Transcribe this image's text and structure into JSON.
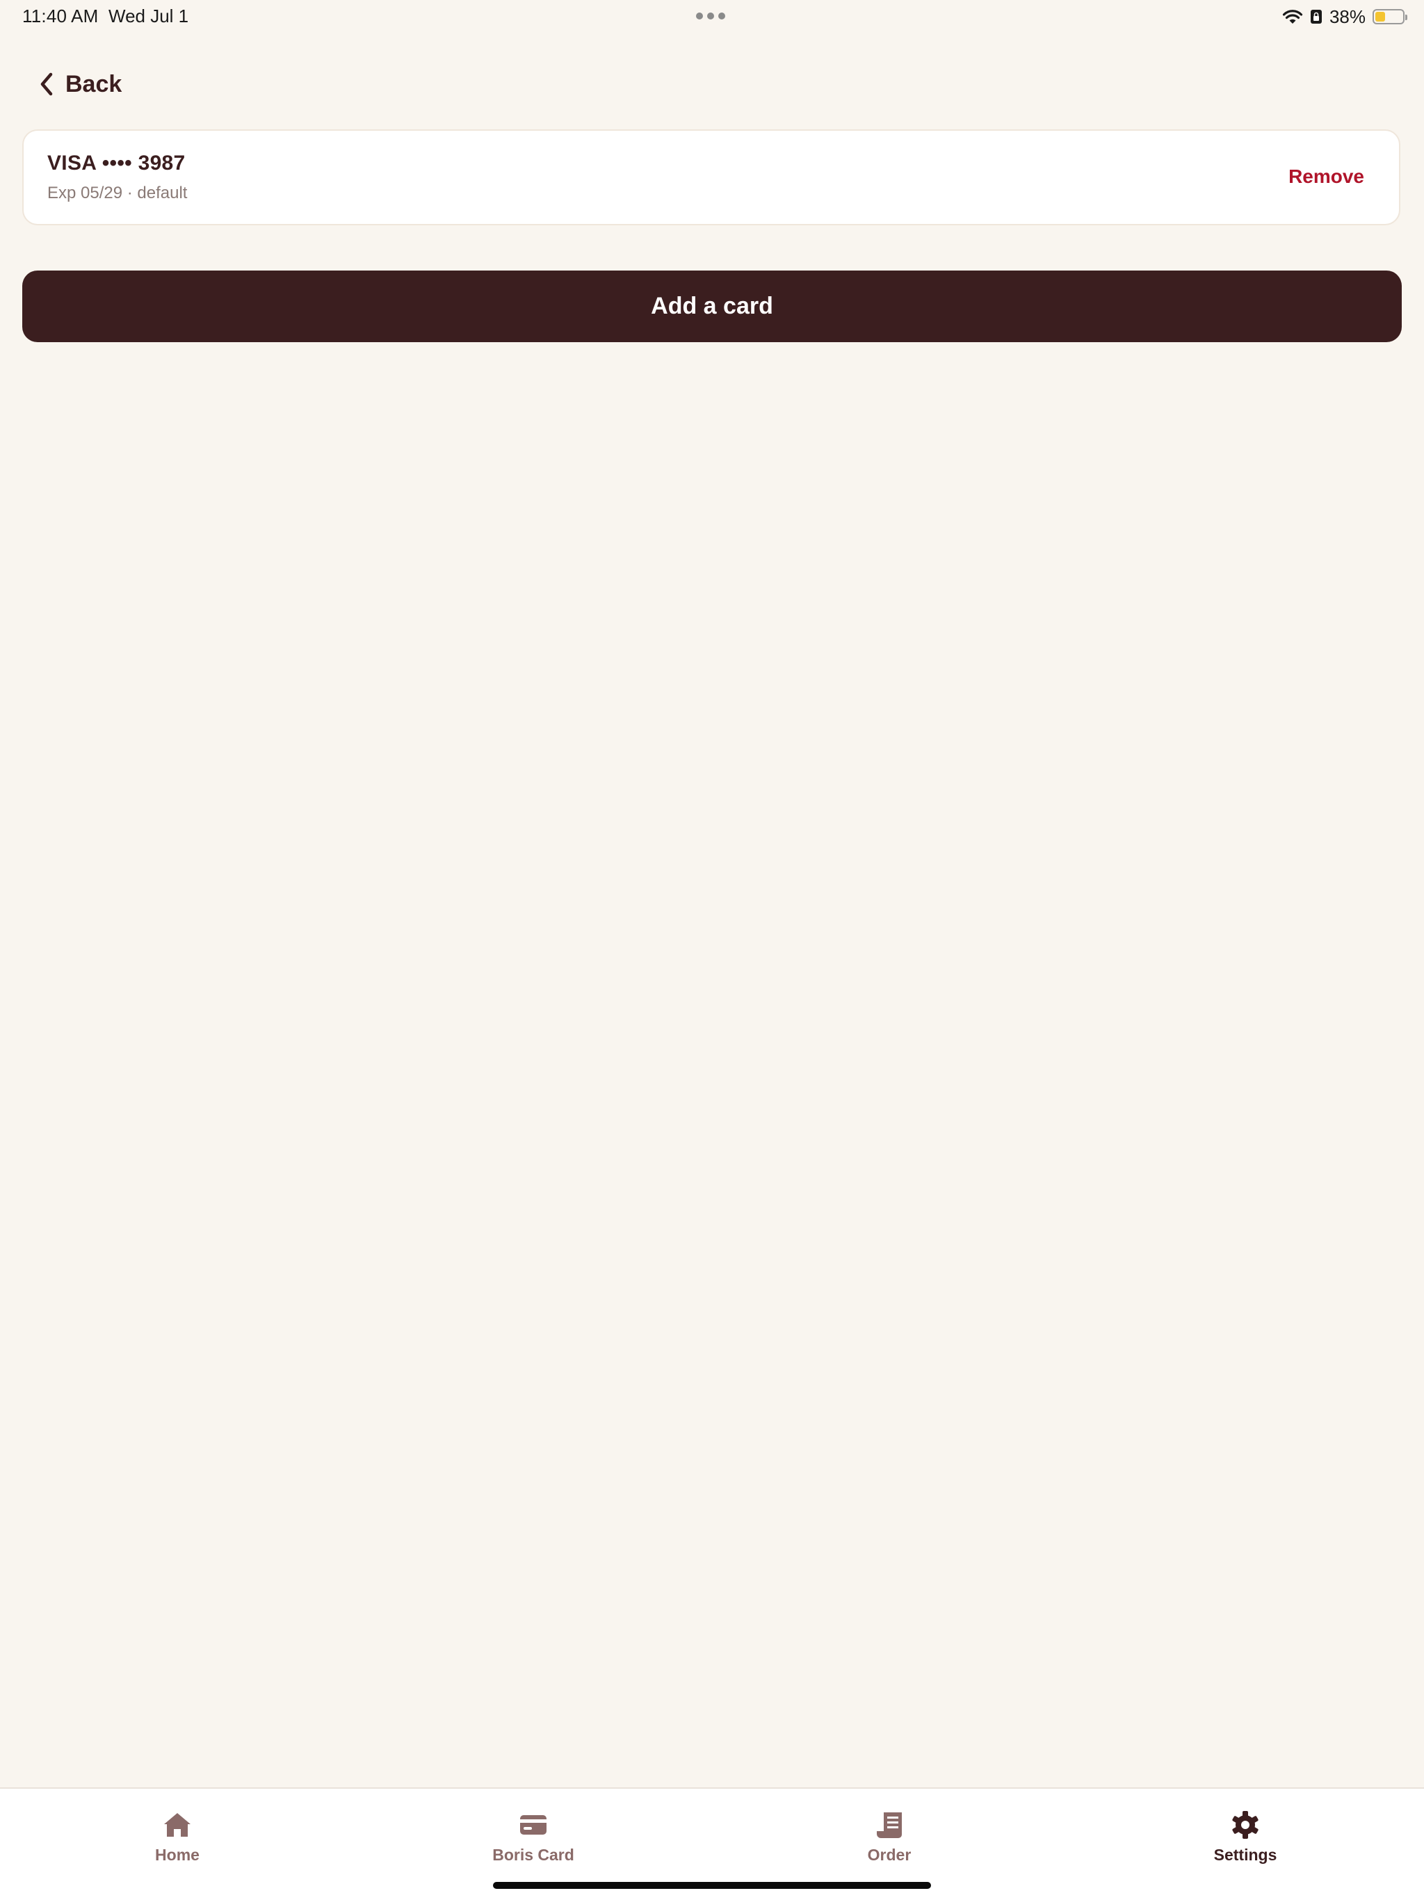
{
  "status_bar": {
    "time": "11:40 AM",
    "date": "Wed Jul 1",
    "battery_percent_label": "38%",
    "battery_level": 0.38,
    "icons": [
      "wifi-icon",
      "lock-rotation-icon",
      "battery-icon"
    ]
  },
  "navigation": {
    "back_label": "Back"
  },
  "payment_method": {
    "title": "VISA •••• 3987",
    "subtitle": "Exp 05/29 · default",
    "remove_label": "Remove"
  },
  "actions": {
    "add_card_label": "Add a card"
  },
  "tab_bar": {
    "tabs": [
      {
        "label": "Home",
        "icon": "home-icon",
        "active": false
      },
      {
        "label": "Boris Card",
        "icon": "card-icon",
        "active": false
      },
      {
        "label": "Order",
        "icon": "receipt-icon",
        "active": false
      },
      {
        "label": "Settings",
        "icon": "gear-icon",
        "active": true
      }
    ]
  },
  "colors": {
    "background": "#f9f5ef",
    "primary": "#3b1e1f",
    "destructive": "#b0142a",
    "tab_inactive": "#8a6a68"
  }
}
